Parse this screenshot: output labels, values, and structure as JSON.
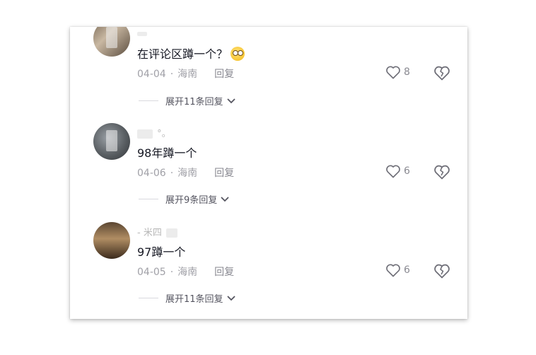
{
  "comments": [
    {
      "username": "",
      "text": "在评论区蹲一个？",
      "has_emoji": true,
      "date": "04-04",
      "location": "海南",
      "reply_label": "回复",
      "likes": "8",
      "expand_label": "展开11条回复"
    },
    {
      "username": "°。",
      "text": "98年蹲一个",
      "has_emoji": false,
      "date": "04-06",
      "location": "海南",
      "reply_label": "回复",
      "likes": "6",
      "expand_label": "展开9条回复"
    },
    {
      "username": "- 米四",
      "text": "97蹲一个",
      "has_emoji": false,
      "date": "04-05",
      "location": "海南",
      "reply_label": "回复",
      "likes": "6",
      "expand_label": "展开11条回复"
    }
  ],
  "icons": {
    "like": "heart-outline-icon",
    "dislike": "broken-heart-icon",
    "expand": "chevron-down-icon"
  },
  "colors": {
    "text": "#161823",
    "meta": "#a0a0a7",
    "background": "#ffffff"
  }
}
